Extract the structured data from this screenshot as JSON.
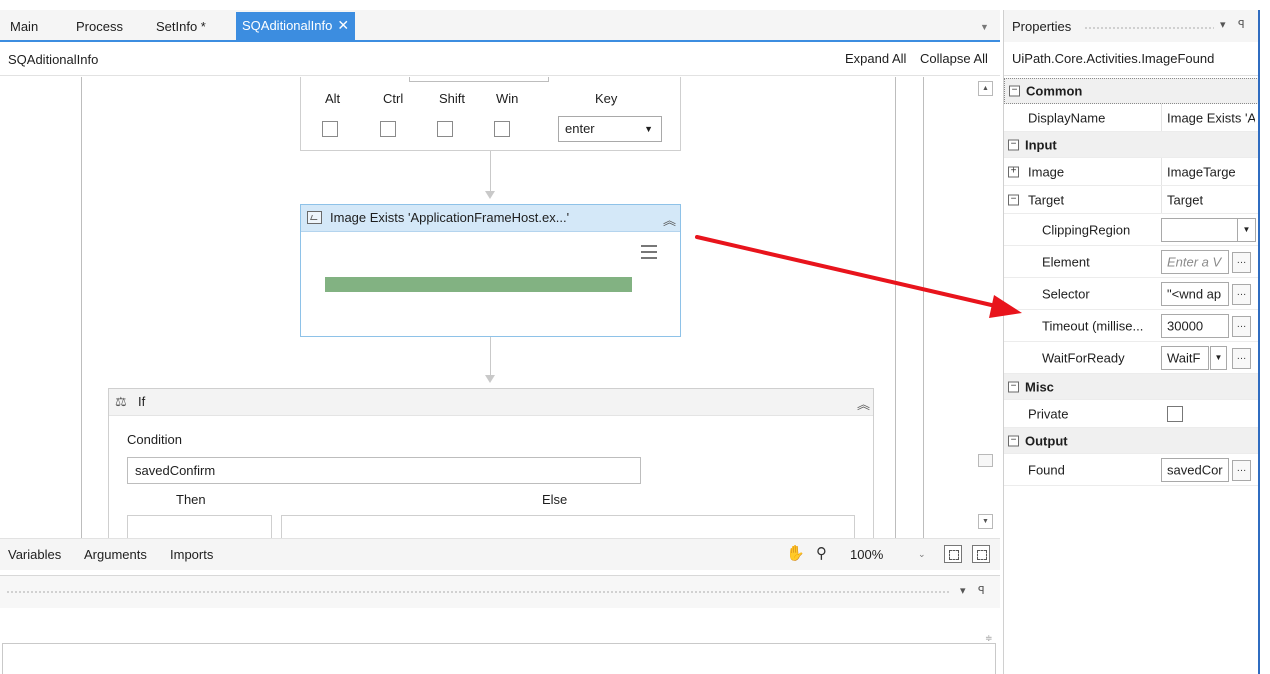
{
  "tabs": [
    {
      "label": "Main"
    },
    {
      "label": "Process"
    },
    {
      "label": "SetInfo *"
    },
    {
      "label": "SQAditionalInfo",
      "close": "✕"
    }
  ],
  "breadcrumb": {
    "current": "SQAditionalInfo",
    "expand_all": "Expand All",
    "collapse_all": "Collapse All"
  },
  "send_hotkey": {
    "modifiers": [
      "Alt",
      "Ctrl",
      "Shift",
      "Win"
    ],
    "key_label": "Key",
    "key_value": "enter"
  },
  "image_exists": {
    "title": "Image Exists 'ApplicationFrameHost.ex...'"
  },
  "if_activity": {
    "title": "If",
    "condition_label": "Condition",
    "condition_value": "savedConfirm",
    "then_label": "Then",
    "else_label": "Else"
  },
  "bottom_bar": {
    "tabs": [
      "Variables",
      "Arguments",
      "Imports"
    ],
    "zoom": "100%"
  },
  "properties": {
    "title": "Properties",
    "type_name": "UiPath.Core.Activities.ImageFound",
    "categories": {
      "common": "Common",
      "input": "Input",
      "misc": "Misc",
      "output": "Output"
    },
    "rows": {
      "display_name": {
        "label": "DisplayName",
        "value": "Image Exists 'A"
      },
      "image": {
        "label": "Image",
        "value": "ImageTarge"
      },
      "target": {
        "label": "Target",
        "value": "Target"
      },
      "clipping_region": {
        "label": "ClippingRegion",
        "value": ""
      },
      "element": {
        "label": "Element",
        "placeholder": "Enter a V"
      },
      "selector": {
        "label": "Selector",
        "value": "\"<wnd ap"
      },
      "timeout": {
        "label": "Timeout (millise...",
        "value": "30000"
      },
      "wait_for_ready": {
        "label": "WaitForReady",
        "value": "WaitF"
      },
      "private": {
        "label": "Private"
      },
      "found": {
        "label": "Found",
        "value": "savedCor"
      }
    }
  },
  "colors": {
    "accent": "#3c8de0",
    "annotation_arrow": "#e8141c",
    "activity_header": "#d4e8f8",
    "progress_bar": "#82b282"
  }
}
